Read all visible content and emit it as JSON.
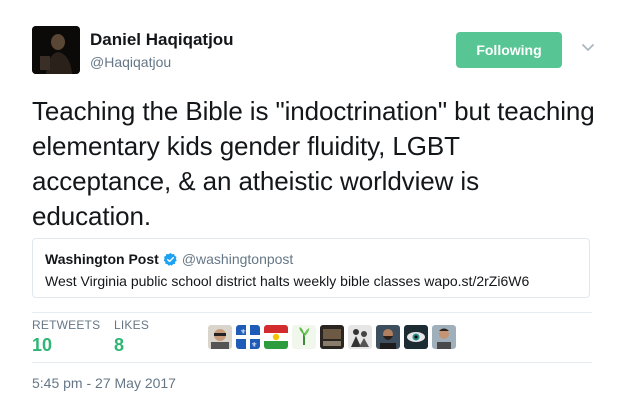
{
  "author": {
    "name": "Daniel Haqiqatjou",
    "handle": "@Haqiqatjou"
  },
  "follow_button": {
    "label": "Following",
    "color": "#57c594"
  },
  "tweet": {
    "text": "Teaching the Bible is \"indoctrination\" but teaching elementary kids gender fluidity, LGBT acceptance, & an atheistic worldview is education."
  },
  "quoted_tweet": {
    "name": "Washington Post",
    "handle": "@washingtonpost",
    "text": "West Virginia public school district halts weekly bible classes wapo.st/2rZi6W6"
  },
  "stats": {
    "retweets_label": "RETWEETS",
    "retweets_value": "10",
    "likes_label": "LIKES",
    "likes_value": "8",
    "value_color": "#2fb673"
  },
  "likers": [
    {
      "icon": "avatar-glasses-man"
    },
    {
      "icon": "avatar-quebec-flag"
    },
    {
      "icon": "avatar-kurdistan-flag"
    },
    {
      "icon": "avatar-green-plant"
    },
    {
      "icon": "avatar-dark-photo"
    },
    {
      "icon": "avatar-figures"
    },
    {
      "icon": "avatar-bearded-man"
    },
    {
      "icon": "avatar-eye"
    },
    {
      "icon": "avatar-man-portrait"
    }
  ],
  "timestamp": "5:45 pm - 27 May 2017"
}
